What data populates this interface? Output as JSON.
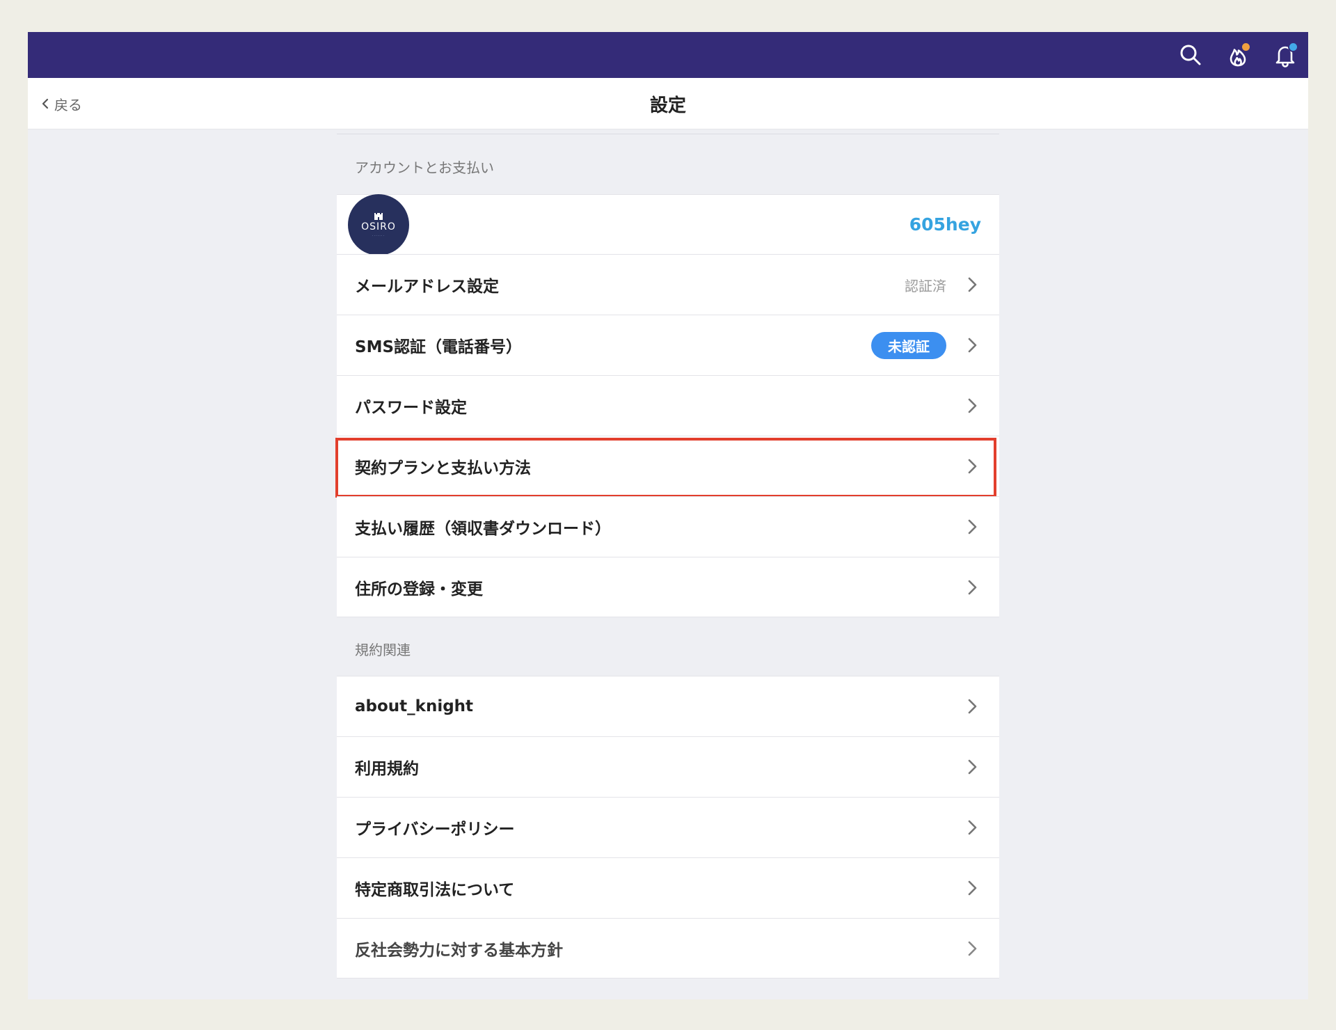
{
  "header": {
    "icons": [
      "search-icon",
      "fire-icon",
      "bell-icon"
    ],
    "fire_badge_color": "#f0a040",
    "bell_badge_color": "#43a8e8",
    "bar_color": "#342b78"
  },
  "nav": {
    "back_label": "戻る",
    "title": "設定"
  },
  "account_section": {
    "header": "アカウントとお支払い",
    "profile": {
      "avatar_text": "OSIRO",
      "username": "605hey"
    },
    "items": [
      {
        "label": "メールアドレス設定",
        "status": "認証済"
      },
      {
        "label": "SMS認証（電話番号）",
        "badge": "未認証"
      },
      {
        "label": "パスワード設定"
      },
      {
        "label": "契約プランと支払い方法"
      },
      {
        "label": "支払い履歴（領収書ダウンロード）"
      },
      {
        "label": "住所の登録・変更"
      }
    ]
  },
  "terms_section": {
    "header": "規約関連",
    "items": [
      {
        "label": "about_knight"
      },
      {
        "label": "利用規約"
      },
      {
        "label": "プライバシーポリシー"
      },
      {
        "label": "特定商取引法について"
      },
      {
        "label": "反社会勢力に対する基本方針"
      }
    ]
  },
  "colors": {
    "accent_blue": "#3c8ff0",
    "username_color": "#35a3e0",
    "highlight_border": "#e23f2d"
  }
}
